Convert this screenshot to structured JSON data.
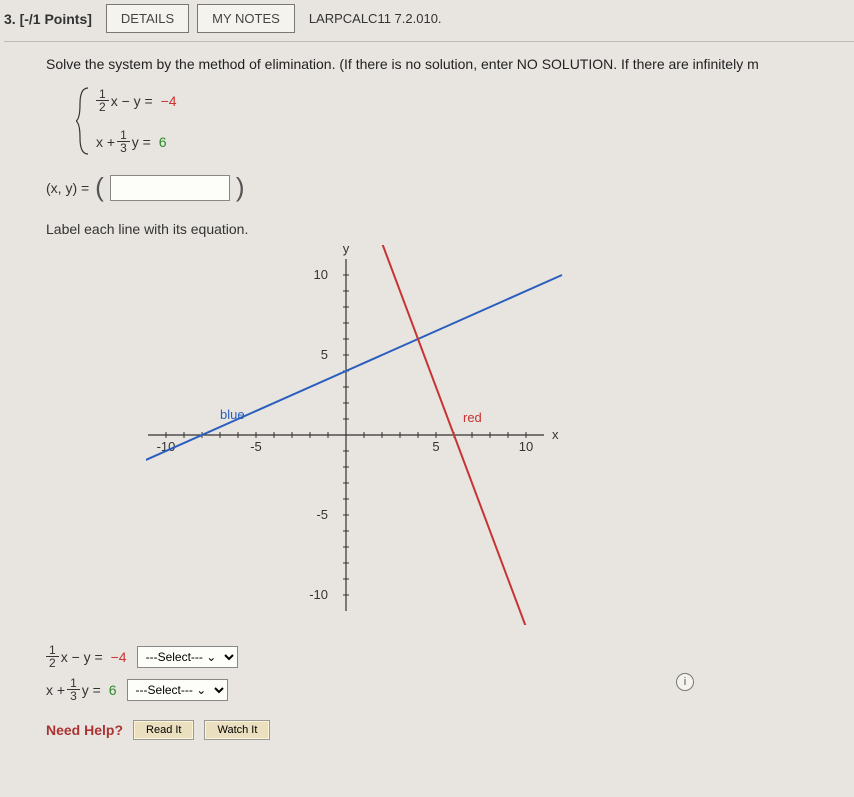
{
  "header": {
    "question_number": "3.",
    "points": "[-/1 Points]",
    "details_label": "DETAILS",
    "notes_label": "MY NOTES",
    "ref_id": "LARPCALC11 7.2.010."
  },
  "intro": "Solve the system by the method of elimination. (If there is no solution, enter NO SOLUTION. If there are infinitely m",
  "system": {
    "eq1": {
      "frac_num": "1",
      "frac_den": "2",
      "middle": "x − y =",
      "rhs": "−4"
    },
    "eq2": {
      "lead": "x +",
      "frac_num": "1",
      "frac_den": "3",
      "middle": "y =",
      "rhs": "6"
    }
  },
  "answer": {
    "lhs": "(x, y) ="
  },
  "label_instruction": "Label each line with its equation.",
  "chart_data": {
    "type": "line",
    "xlabel": "x",
    "ylabel": "y",
    "xlim": [
      -10,
      10
    ],
    "ylim": [
      -10,
      10
    ],
    "ticks_x": [
      -10,
      -5,
      5,
      10
    ],
    "ticks_y": [
      -10,
      -5,
      5,
      10
    ],
    "annotations": [
      {
        "text": "blue",
        "x": -7,
        "y": 1,
        "color": "#2a5fbf"
      },
      {
        "text": "red",
        "x": 6.5,
        "y": 0.8,
        "color": "#c63333"
      }
    ],
    "series": [
      {
        "name": "blue",
        "color": "#2a5fbf",
        "points": [
          [
            -12,
            -2
          ],
          [
            12,
            10
          ]
        ]
      },
      {
        "name": "red",
        "color": "#c63333",
        "points": [
          [
            1.5,
            13.5
          ],
          [
            10,
            -12
          ]
        ]
      }
    ]
  },
  "selects": {
    "row1_eq_frac_num": "1",
    "row1_eq_frac_den": "2",
    "row1_eq_mid": "x − y =",
    "row1_eq_rhs": "−4",
    "row2_eq_lead": "x +",
    "row2_eq_frac_num": "1",
    "row2_eq_frac_den": "3",
    "row2_eq_mid": "y =",
    "row2_eq_rhs": "6",
    "placeholder": "---Select--- ⌄"
  },
  "help": {
    "label": "Need Help?",
    "read": "Read It",
    "watch": "Watch It"
  },
  "info_icon": "i"
}
